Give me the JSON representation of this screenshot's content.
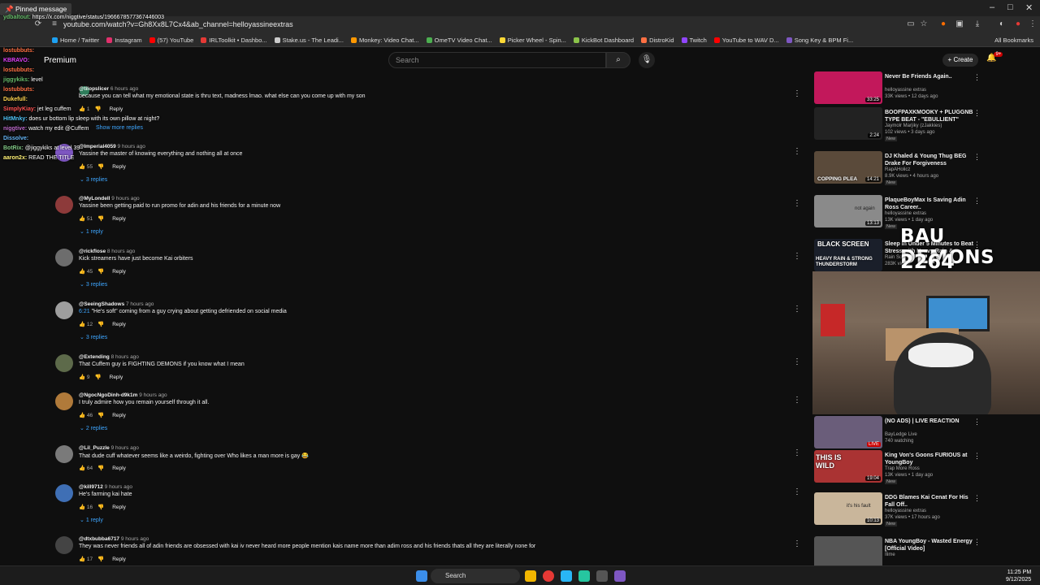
{
  "browser": {
    "url": "youtube.com/watch?v=Gh8Xx8L7Cx4&ab_channel=helloyassineextras",
    "window_controls": [
      "–",
      "□",
      "✕"
    ],
    "bookmarks": [
      "Home / Twitter",
      "Instagram",
      "(57) YouTube",
      "IRLToolkit • Dashbo...",
      "Stake.us - The Leadi...",
      "Monkey: Video Chat...",
      "OmeTV Video Chat...",
      "Picker Wheel - Spin...",
      "KickBot Dashboard",
      "DistroKid",
      "Twitch",
      "YouTube to WAV D...",
      "Song Key & BPM Fi..."
    ],
    "all_bookmarks": "All Bookmarks"
  },
  "chat": {
    "pinned": "Pinned message",
    "pinned_line": {
      "user": "ydbaltout:",
      "text": "https://x.com/niggtive/status/1966678577367446003"
    },
    "lines": [
      {
        "user": "lostubbuts:",
        "text": "",
        "color": "#ff7043"
      },
      {
        "user": "KBRAVO:",
        "text": "",
        "color": "#e040fb"
      },
      {
        "user": "lostubbuts:",
        "text": "",
        "color": "#ff7043"
      },
      {
        "user": "jiggykiks:",
        "text": "level",
        "color": "#66bb6a"
      },
      {
        "user": "lostubbuts:",
        "text": "",
        "color": "#ff7043"
      },
      {
        "user": "Dukefull:",
        "text": "",
        "color": "#ffd54f"
      },
      {
        "user": "SimplyKiay:",
        "text": "jet leg cuffem",
        "color": "#ff5252"
      },
      {
        "user": "HitMnky:",
        "text": "does ur bottom lip sleep with its own pillow at night?",
        "color": "#4fc3f7"
      },
      {
        "user": "niggtive:",
        "text": "watch my edit @Cuffem",
        "color": "#ba68c8"
      },
      {
        "user": "Dissolve:",
        "text": "",
        "color": "#64b5f6"
      },
      {
        "user": "BotRix:",
        "text": "@jiggykiks at level 39",
        "color": "#81c784"
      },
      {
        "user": "aaron2x:",
        "text": "READ THE TITLE",
        "color": "#fff176"
      }
    ]
  },
  "yt": {
    "logo_suffix": "Premium",
    "search_placeholder": "Search",
    "create": "Create",
    "notif_count": "9+"
  },
  "comments": [
    {
      "handle": "@tilopslicer",
      "time": "6 hours ago",
      "text": "because you can tell what my emotional state is thru text, madness lmao. what else can you come up with my son",
      "likes": "1",
      "replies": "",
      "avatar": "#2e7d5b"
    },
    {
      "handle": "@Imperial4059",
      "time": "9 hours ago",
      "text": "Yassine the master of knowing everything and nothing all at once",
      "likes": "55",
      "replies": "3 replies",
      "avatar": "#7e57c2"
    },
    {
      "handle": "@MyLondell",
      "time": "9 hours ago",
      "text": "Yassine been getting paid to run promo for adin and his friends for a minute now",
      "likes": "51",
      "replies": "1 reply",
      "avatar": "#8d3a3a"
    },
    {
      "handle": "@rickflose",
      "time": "8 hours ago",
      "text": "Kick streamers have just become Kai orbiters",
      "likes": "45",
      "replies": "3 replies",
      "avatar": "#6d6d6d"
    },
    {
      "handle": "@SeeingShadows",
      "time": "7 hours ago",
      "ts": "6:21",
      "text": " \"He's soft\" coming from a guy crying about getting defriended on social media",
      "likes": "12",
      "replies": "3 replies",
      "avatar": "#9e9e9e"
    },
    {
      "handle": "@Extending",
      "time": "8 hours ago",
      "text": "That Cuffem guy is FIGHTING DEMONS if you know what I mean",
      "likes": "9",
      "replies": "",
      "avatar": "#5d6a4a"
    },
    {
      "handle": "@NgocNgoDinh-d9k1m",
      "time": "9 hours ago",
      "text": "I truly admire how you remain yourself through it all.",
      "likes": "46",
      "replies": "2 replies",
      "avatar": "#b07a3a"
    },
    {
      "handle": "@Lil_Puzzle",
      "time": "9 hours ago",
      "text": "That dude cuff whatever seems like a weirdo, fighting over Who likes a man more is gay 😂",
      "likes": "64",
      "replies": "",
      "avatar": "#7a7a7a"
    },
    {
      "handle": "@kill9712",
      "time": "9 hours ago",
      "text": "He's farming kai hate",
      "likes": "16",
      "replies": "1 reply",
      "avatar": "#3f6fb5"
    },
    {
      "handle": "@dtxbubba6717",
      "time": "9 hours ago",
      "text": "They was never friends all of adin friends are obsessed with kai iv never heard more people mention kais name more than adim ross and his friends thats all they are literally none for",
      "likes": "17",
      "replies": "",
      "avatar": "#444"
    }
  ],
  "comment_reply_label": "Reply",
  "show_more_replies": "Show more replies",
  "sidebar": [
    {
      "title": "Never Be Friends Again..",
      "channel": "helloyassine extras",
      "stats": "33K views • 12 days ago",
      "badge": "",
      "duration": "33:25",
      "thumb": "#c2185b"
    },
    {
      "title": "BOOFPAXKMOOKY + PLUGGNB TYPE BEAT - \"EBULLIENT\"",
      "channel": "Jaymolr Marjiky (zJakkies)",
      "stats": "102 views • 3 days ago",
      "badge": "New",
      "duration": "2:24",
      "thumb": "#222"
    },
    {
      "title": "DJ Khaled & Young Thug BEG Drake For Forgiveness",
      "channel": "RapAHolicz",
      "stats": "8.9K views • 4 hours ago",
      "badge": "New",
      "duration": "14:21",
      "thumb": "#5a4a3a"
    },
    {
      "title": "PlaqueBoyMax Is Saving Adin Ross Career..",
      "channel": "helloyassine extras",
      "stats": "13K views • 1 day ago",
      "badge": "New",
      "duration": "13:13",
      "thumb": "#8a8a8a"
    },
    {
      "title": "Sleep in Under 5 Minutes to Beat Stress with Heavy Rain & ...",
      "channel": "Rain Sounds",
      "stats": "283K views",
      "badge": "",
      "duration": "",
      "thumb": "#1a1f2a"
    }
  ],
  "sidebar_lower": [
    {
      "title": "(NO ADS) | LIVE REACTION",
      "channel": "BayLedge Live",
      "stats": "740 watching",
      "badge": "",
      "duration": "LIVE",
      "thumb": "#6a5d7a"
    },
    {
      "title": "King Von's Goons FURIOUS at YoungBoy",
      "channel": "Trap More Ross",
      "stats": "13K views • 1 day ago",
      "badge": "New",
      "duration": "19:04",
      "thumb": "#a33"
    },
    {
      "title": "DDG Blames Kai Cenat For His Fall Off..",
      "channel": "helloyassine extras",
      "stats": "37K views • 17 hours ago",
      "badge": "New",
      "duration": "10:13",
      "thumb": "#c9b69b"
    },
    {
      "title": "NBA YoungBoy - Wasted Energy [Official Video]",
      "channel": "Ilime",
      "stats": "",
      "badge": "",
      "duration": "",
      "thumb": "#555"
    }
  ],
  "thumb_text": {
    "coping": "COPPING PLEA",
    "not_again": "not again",
    "black_screen": "BLACK SCREEN",
    "heavy_rain": "HEAVY RAIN & STRONG THUNDERSTORM",
    "this_is_wild": "THIS IS WILD",
    "its_his_fault": "it's his fault"
  },
  "stream": {
    "title": "BAU DEMONS",
    "number": "2264"
  },
  "taskbar": {
    "search": "Search",
    "time": "11:25 PM",
    "date": "9/12/2025"
  }
}
